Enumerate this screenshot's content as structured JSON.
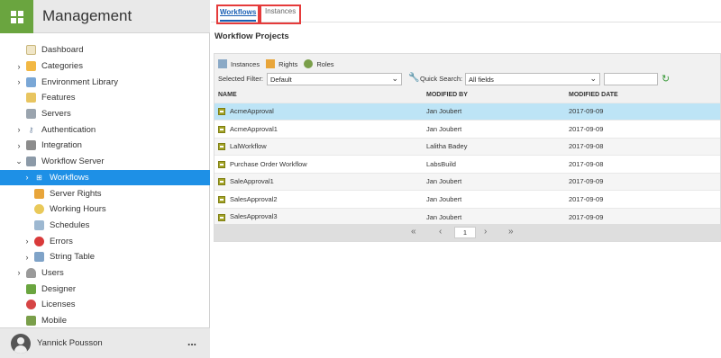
{
  "sidebar": {
    "title": "Management",
    "items": [
      {
        "label": "Dashboard",
        "icon": "dashboard-icon"
      },
      {
        "label": "Categories",
        "icon": "folder-icon"
      },
      {
        "label": "Environment Library",
        "icon": "library-icon"
      },
      {
        "label": "Features",
        "icon": "features-icon"
      },
      {
        "label": "Servers",
        "icon": "server-icon"
      },
      {
        "label": "Authentication",
        "icon": "key-icon"
      },
      {
        "label": "Integration",
        "icon": "puzzle-icon"
      },
      {
        "label": "Workflow Server",
        "icon": "workflow-server-icon"
      },
      {
        "label": "Workflows",
        "icon": "workflows-icon"
      },
      {
        "label": "Server Rights",
        "icon": "lock-icon"
      },
      {
        "label": "Working Hours",
        "icon": "clock-icon"
      },
      {
        "label": "Schedules",
        "icon": "schedule-icon"
      },
      {
        "label": "Errors",
        "icon": "error-icon"
      },
      {
        "label": "String Table",
        "icon": "string-table-icon"
      },
      {
        "label": "Users",
        "icon": "user-icon"
      },
      {
        "label": "Designer",
        "icon": "designer-icon"
      },
      {
        "label": "Licenses",
        "icon": "license-icon"
      },
      {
        "label": "Mobile",
        "icon": "mobile-icon"
      }
    ],
    "footer": {
      "user_name": "Yannick Pousson",
      "more_label": "..."
    }
  },
  "tabs": [
    {
      "label": "Workflows",
      "active": true
    },
    {
      "label": "Instances",
      "active": false
    }
  ],
  "section_title": "Workflow Projects",
  "toolbar": {
    "instances_label": "Instances",
    "rights_label": "Rights",
    "roles_label": "Roles",
    "selected_filter_label": "Selected Filter:",
    "selected_filter_value": "Default",
    "quick_search_label": "Quick Search:",
    "quick_search_field": "All fields",
    "search_value": ""
  },
  "table": {
    "headers": [
      "NAME",
      "MODIFIED BY",
      "MODIFIED DATE"
    ],
    "rows": [
      {
        "name": "AcmeApproval",
        "modified_by": "Jan Joubert",
        "modified_date": "2017-09-09",
        "selected": true
      },
      {
        "name": "AcmeApproval1",
        "modified_by": "Jan Joubert",
        "modified_date": "2017-09-09",
        "selected": false
      },
      {
        "name": "LalWorkflow",
        "modified_by": "Lalitha Badey",
        "modified_date": "2017-09-08",
        "selected": false
      },
      {
        "name": "Purchase Order Workflow",
        "modified_by": "LabsBuild",
        "modified_date": "2017-09-08",
        "selected": false
      },
      {
        "name": "SaleApproval1",
        "modified_by": "Jan Joubert",
        "modified_date": "2017-09-09",
        "selected": false
      },
      {
        "name": "SalesApproval2",
        "modified_by": "Jan Joubert",
        "modified_date": "2017-09-09",
        "selected": false
      },
      {
        "name": "SalesApproval3",
        "modified_by": "Jan Joubert",
        "modified_date": "2017-09-09",
        "selected": false
      }
    ]
  },
  "pager": {
    "current_page": "1"
  },
  "colors": {
    "accent": "#1e90e6",
    "brand": "#6aa53f",
    "selected_row": "#bde4f6",
    "highlight_border": "#e53b3b"
  }
}
